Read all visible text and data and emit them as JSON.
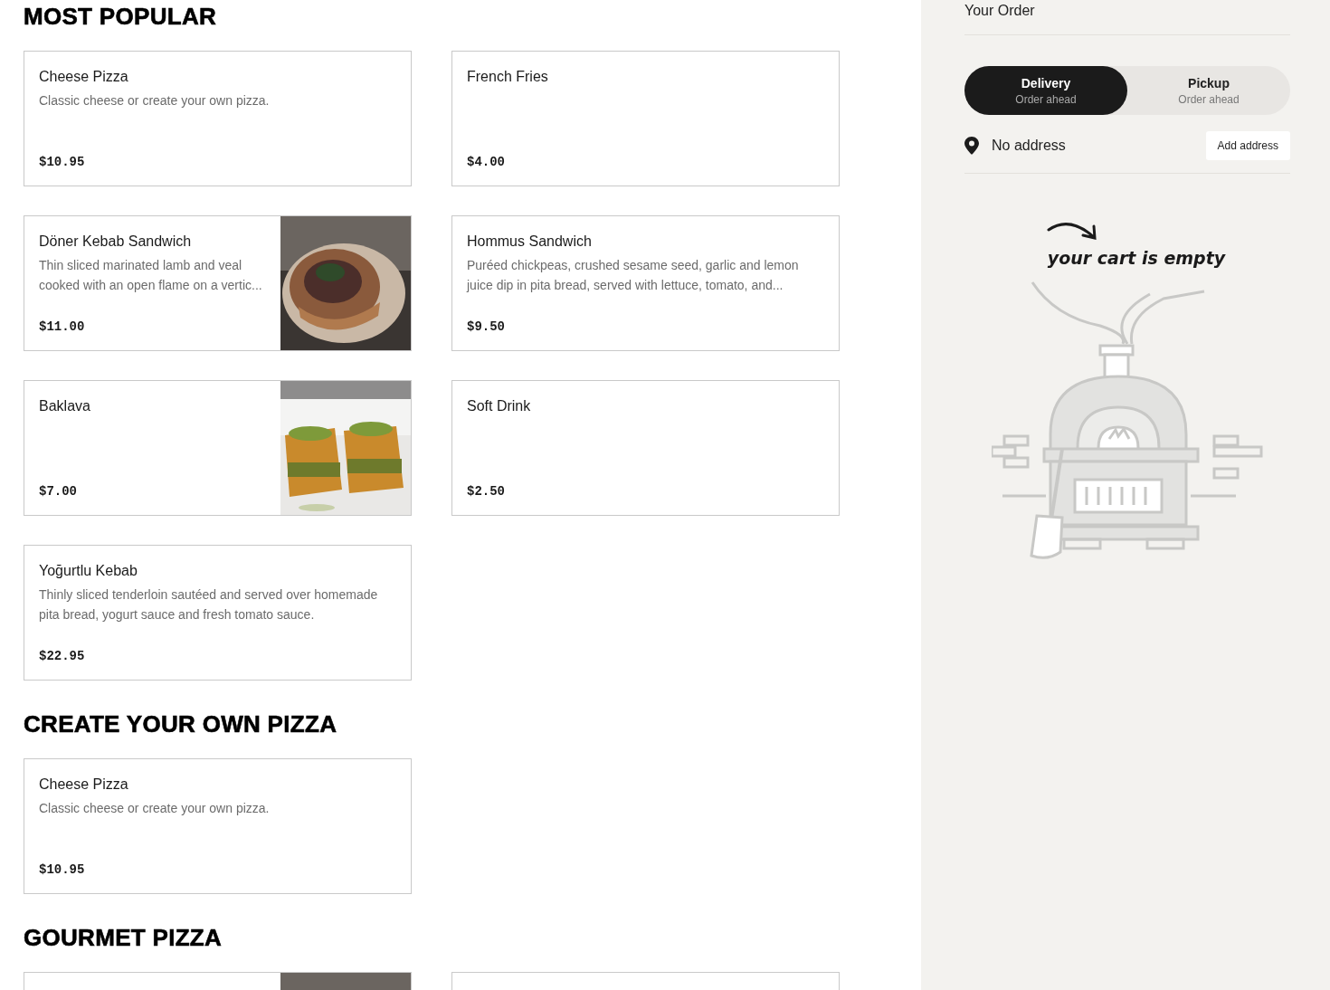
{
  "sections": [
    {
      "title": "MOST POPULAR",
      "items": [
        {
          "name": "Cheese Pizza",
          "description": "Classic cheese or create your own pizza.",
          "price": "$10.95",
          "photo": false
        },
        {
          "name": "French Fries",
          "price": "$4.00",
          "photo": false
        },
        {
          "name": "Döner Kebab Sandwich",
          "description": "Thin sliced marinated lamb and veal cooked with an open flame on a vertic...",
          "price": "$11.00",
          "photo": true
        },
        {
          "name": "Hommus Sandwich",
          "description": "Puréed chickpeas, crushed sesame seed, garlic and lemon juice dip in pita bread, served with lettuce, tomato, and...",
          "price": "$9.50",
          "photo": false
        },
        {
          "name": "Baklava",
          "price": "$7.00",
          "photo": true
        },
        {
          "name": "Soft Drink",
          "price": "$2.50",
          "photo": false
        },
        {
          "name": "Yoğurtlu Kebab",
          "description": "Thinly sliced tenderloin sautéed and served over homemade pita bread, yogurt sauce and fresh tomato sauce.",
          "price": "$22.95",
          "photo": false
        }
      ]
    },
    {
      "title": "CREATE YOUR OWN PIZZA",
      "items": [
        {
          "name": "Cheese Pizza",
          "description": "Classic cheese or create your own pizza.",
          "price": "$10.95",
          "photo": false
        }
      ]
    },
    {
      "title": "GOURMET PIZZA",
      "items": [
        {
          "photo": true
        },
        {
          "photo": false
        }
      ]
    }
  ],
  "order": {
    "title": "Your Order",
    "modes": [
      {
        "label": "Delivery",
        "sublabel": "Order ahead",
        "selected": true
      },
      {
        "label": "Pickup",
        "sublabel": "Order ahead",
        "selected": false
      }
    ],
    "address": "No address",
    "add_address_button": "Add address",
    "empty_message": "your cart is empty"
  }
}
